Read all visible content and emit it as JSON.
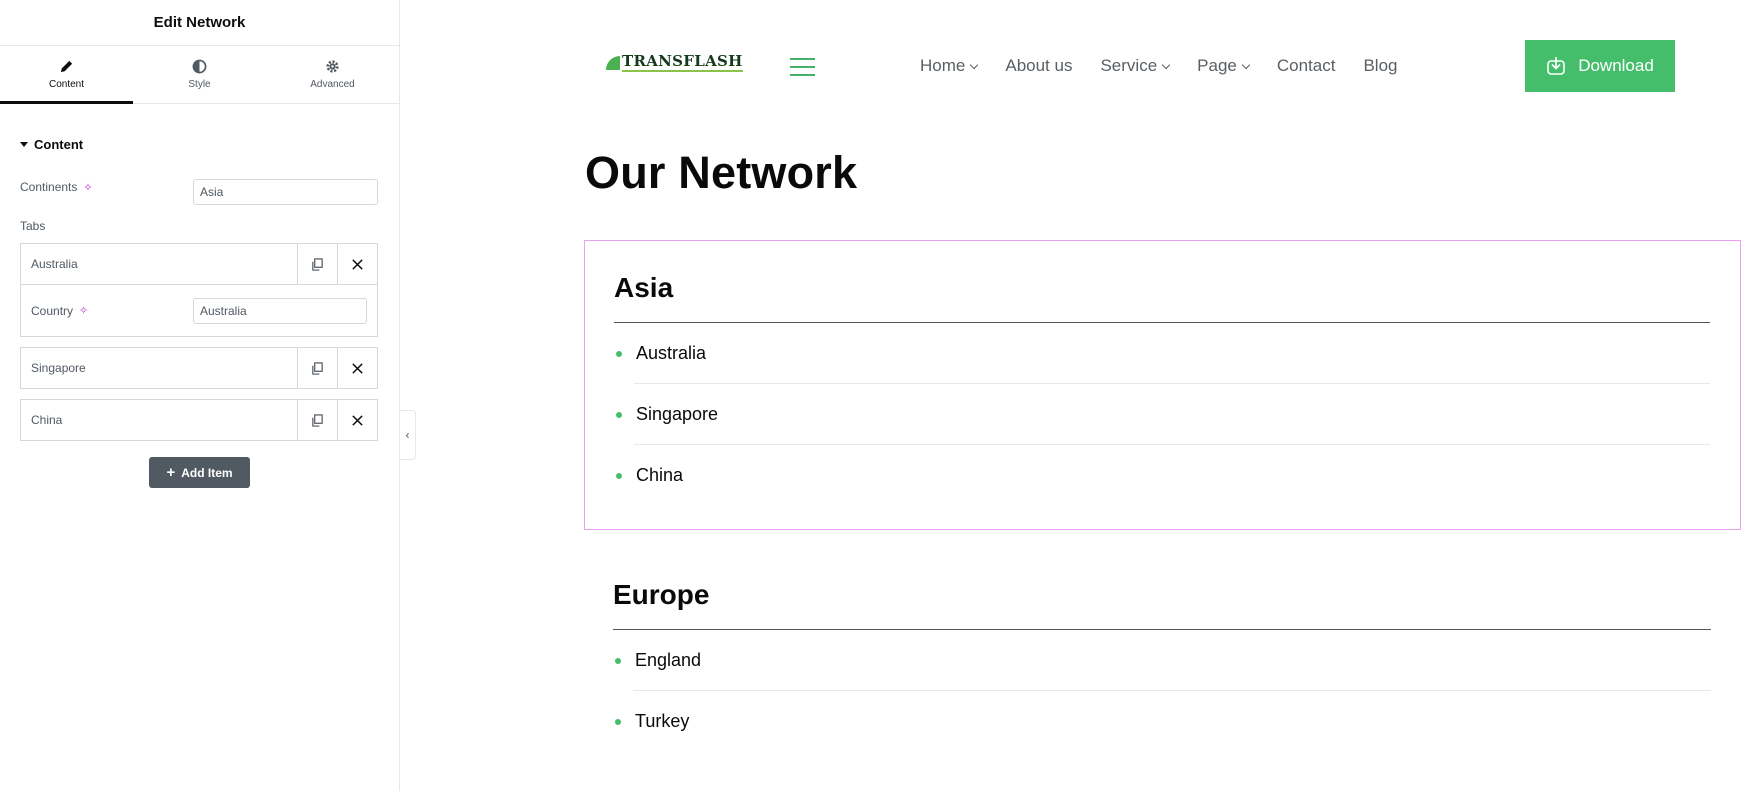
{
  "panel": {
    "title": "Edit Network",
    "tabs": [
      {
        "label": "Content",
        "icon": "pencil-icon",
        "active": true
      },
      {
        "label": "Style",
        "icon": "contrast-icon",
        "active": false
      },
      {
        "label": "Advanced",
        "icon": "gear-icon",
        "active": false
      }
    ],
    "section_title": "Content",
    "continents_label": "Continents",
    "continents_value": "Asia",
    "tabs_label": "Tabs",
    "items": [
      {
        "title": "Australia",
        "expanded": true,
        "country_label": "Country",
        "country_value": "Australia"
      },
      {
        "title": "Singapore",
        "expanded": false
      },
      {
        "title": "China",
        "expanded": false
      }
    ],
    "add_item_label": "Add Item"
  },
  "site": {
    "logo_text": "TRANSFLASH",
    "nav": [
      {
        "label": "Home",
        "has_dropdown": true
      },
      {
        "label": "About us",
        "has_dropdown": false
      },
      {
        "label": "Service",
        "has_dropdown": true
      },
      {
        "label": "Page",
        "has_dropdown": true
      },
      {
        "label": "Contact",
        "has_dropdown": false
      },
      {
        "label": "Blog",
        "has_dropdown": false
      }
    ],
    "download_label": "Download",
    "page_title": "Our Network",
    "continents": [
      {
        "name": "Asia",
        "selected": true,
        "countries": [
          "Australia",
          "Singapore",
          "China"
        ]
      },
      {
        "name": "Europe",
        "selected": false,
        "countries": [
          "England",
          "Turkey"
        ]
      }
    ]
  },
  "colors": {
    "accent_green": "#45be6b",
    "selection_outline": "#ec9ff0",
    "ai_magenta": "#c026d3",
    "panel_button": "#515962"
  }
}
